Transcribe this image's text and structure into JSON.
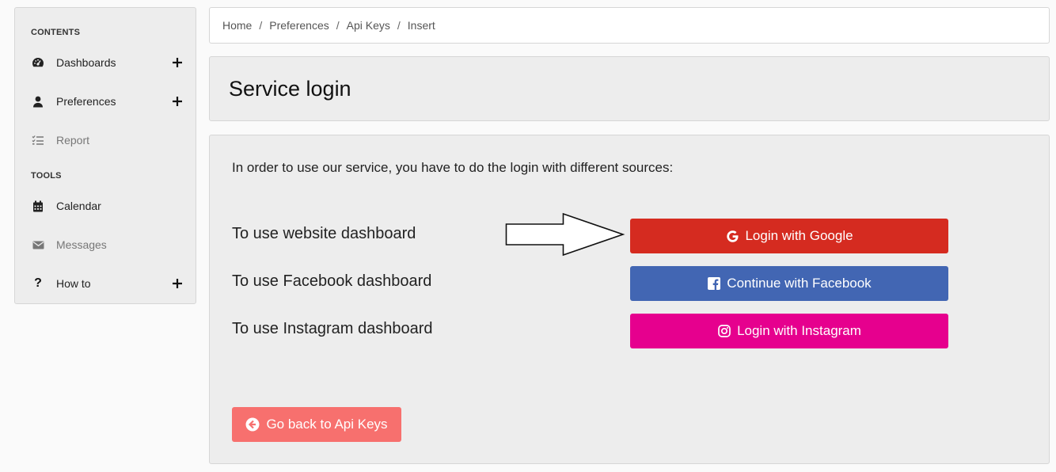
{
  "sidebar": {
    "contents_heading": "CONTENTS",
    "tools_heading": "TOOLS",
    "items": [
      {
        "label": "Dashboards",
        "icon": "dashboard-icon"
      },
      {
        "label": "Preferences",
        "icon": "user-icon"
      },
      {
        "label": "Report",
        "icon": "list-check-icon"
      },
      {
        "label": "Calendar",
        "icon": "calendar-icon"
      },
      {
        "label": "Messages",
        "icon": "envelope-icon"
      },
      {
        "label": "How to",
        "icon": "question-icon"
      }
    ]
  },
  "breadcrumb": [
    "Home",
    "Preferences",
    "Api Keys",
    "Insert"
  ],
  "page": {
    "title": "Service login",
    "intro": "In order to use our service, you have to do the login with different sources:",
    "rows": [
      {
        "label": "To use website dashboard",
        "button": "Login with Google",
        "color": "#d52b20",
        "icon": "google-icon"
      },
      {
        "label": "To use Facebook dashboard",
        "button": "Continue with Facebook",
        "color": "#4266b3",
        "icon": "facebook-icon"
      },
      {
        "label": "To use Instagram dashboard",
        "button": "Login with Instagram",
        "color": "#e6008e",
        "icon": "instagram-icon"
      }
    ],
    "back_button": "Go back to Api Keys",
    "back_button_color": "#f7706e"
  }
}
